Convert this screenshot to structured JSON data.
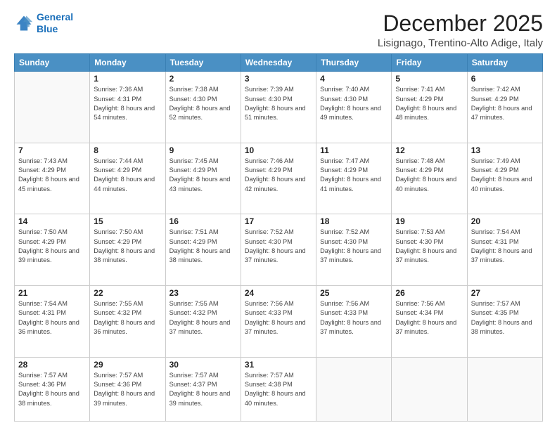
{
  "header": {
    "logo_line1": "General",
    "logo_line2": "Blue",
    "month": "December 2025",
    "location": "Lisignago, Trentino-Alto Adige, Italy"
  },
  "weekdays": [
    "Sunday",
    "Monday",
    "Tuesday",
    "Wednesday",
    "Thursday",
    "Friday",
    "Saturday"
  ],
  "weeks": [
    [
      {
        "day": "",
        "sunrise": "",
        "sunset": "",
        "daylight": ""
      },
      {
        "day": "1",
        "sunrise": "Sunrise: 7:36 AM",
        "sunset": "Sunset: 4:31 PM",
        "daylight": "Daylight: 8 hours and 54 minutes."
      },
      {
        "day": "2",
        "sunrise": "Sunrise: 7:38 AM",
        "sunset": "Sunset: 4:30 PM",
        "daylight": "Daylight: 8 hours and 52 minutes."
      },
      {
        "day": "3",
        "sunrise": "Sunrise: 7:39 AM",
        "sunset": "Sunset: 4:30 PM",
        "daylight": "Daylight: 8 hours and 51 minutes."
      },
      {
        "day": "4",
        "sunrise": "Sunrise: 7:40 AM",
        "sunset": "Sunset: 4:30 PM",
        "daylight": "Daylight: 8 hours and 49 minutes."
      },
      {
        "day": "5",
        "sunrise": "Sunrise: 7:41 AM",
        "sunset": "Sunset: 4:29 PM",
        "daylight": "Daylight: 8 hours and 48 minutes."
      },
      {
        "day": "6",
        "sunrise": "Sunrise: 7:42 AM",
        "sunset": "Sunset: 4:29 PM",
        "daylight": "Daylight: 8 hours and 47 minutes."
      }
    ],
    [
      {
        "day": "7",
        "sunrise": "Sunrise: 7:43 AM",
        "sunset": "Sunset: 4:29 PM",
        "daylight": "Daylight: 8 hours and 45 minutes."
      },
      {
        "day": "8",
        "sunrise": "Sunrise: 7:44 AM",
        "sunset": "Sunset: 4:29 PM",
        "daylight": "Daylight: 8 hours and 44 minutes."
      },
      {
        "day": "9",
        "sunrise": "Sunrise: 7:45 AM",
        "sunset": "Sunset: 4:29 PM",
        "daylight": "Daylight: 8 hours and 43 minutes."
      },
      {
        "day": "10",
        "sunrise": "Sunrise: 7:46 AM",
        "sunset": "Sunset: 4:29 PM",
        "daylight": "Daylight: 8 hours and 42 minutes."
      },
      {
        "day": "11",
        "sunrise": "Sunrise: 7:47 AM",
        "sunset": "Sunset: 4:29 PM",
        "daylight": "Daylight: 8 hours and 41 minutes."
      },
      {
        "day": "12",
        "sunrise": "Sunrise: 7:48 AM",
        "sunset": "Sunset: 4:29 PM",
        "daylight": "Daylight: 8 hours and 40 minutes."
      },
      {
        "day": "13",
        "sunrise": "Sunrise: 7:49 AM",
        "sunset": "Sunset: 4:29 PM",
        "daylight": "Daylight: 8 hours and 40 minutes."
      }
    ],
    [
      {
        "day": "14",
        "sunrise": "Sunrise: 7:50 AM",
        "sunset": "Sunset: 4:29 PM",
        "daylight": "Daylight: 8 hours and 39 minutes."
      },
      {
        "day": "15",
        "sunrise": "Sunrise: 7:50 AM",
        "sunset": "Sunset: 4:29 PM",
        "daylight": "Daylight: 8 hours and 38 minutes."
      },
      {
        "day": "16",
        "sunrise": "Sunrise: 7:51 AM",
        "sunset": "Sunset: 4:29 PM",
        "daylight": "Daylight: 8 hours and 38 minutes."
      },
      {
        "day": "17",
        "sunrise": "Sunrise: 7:52 AM",
        "sunset": "Sunset: 4:30 PM",
        "daylight": "Daylight: 8 hours and 37 minutes."
      },
      {
        "day": "18",
        "sunrise": "Sunrise: 7:52 AM",
        "sunset": "Sunset: 4:30 PM",
        "daylight": "Daylight: 8 hours and 37 minutes."
      },
      {
        "day": "19",
        "sunrise": "Sunrise: 7:53 AM",
        "sunset": "Sunset: 4:30 PM",
        "daylight": "Daylight: 8 hours and 37 minutes."
      },
      {
        "day": "20",
        "sunrise": "Sunrise: 7:54 AM",
        "sunset": "Sunset: 4:31 PM",
        "daylight": "Daylight: 8 hours and 37 minutes."
      }
    ],
    [
      {
        "day": "21",
        "sunrise": "Sunrise: 7:54 AM",
        "sunset": "Sunset: 4:31 PM",
        "daylight": "Daylight: 8 hours and 36 minutes."
      },
      {
        "day": "22",
        "sunrise": "Sunrise: 7:55 AM",
        "sunset": "Sunset: 4:32 PM",
        "daylight": "Daylight: 8 hours and 36 minutes."
      },
      {
        "day": "23",
        "sunrise": "Sunrise: 7:55 AM",
        "sunset": "Sunset: 4:32 PM",
        "daylight": "Daylight: 8 hours and 37 minutes."
      },
      {
        "day": "24",
        "sunrise": "Sunrise: 7:56 AM",
        "sunset": "Sunset: 4:33 PM",
        "daylight": "Daylight: 8 hours and 37 minutes."
      },
      {
        "day": "25",
        "sunrise": "Sunrise: 7:56 AM",
        "sunset": "Sunset: 4:33 PM",
        "daylight": "Daylight: 8 hours and 37 minutes."
      },
      {
        "day": "26",
        "sunrise": "Sunrise: 7:56 AM",
        "sunset": "Sunset: 4:34 PM",
        "daylight": "Daylight: 8 hours and 37 minutes."
      },
      {
        "day": "27",
        "sunrise": "Sunrise: 7:57 AM",
        "sunset": "Sunset: 4:35 PM",
        "daylight": "Daylight: 8 hours and 38 minutes."
      }
    ],
    [
      {
        "day": "28",
        "sunrise": "Sunrise: 7:57 AM",
        "sunset": "Sunset: 4:36 PM",
        "daylight": "Daylight: 8 hours and 38 minutes."
      },
      {
        "day": "29",
        "sunrise": "Sunrise: 7:57 AM",
        "sunset": "Sunset: 4:36 PM",
        "daylight": "Daylight: 8 hours and 39 minutes."
      },
      {
        "day": "30",
        "sunrise": "Sunrise: 7:57 AM",
        "sunset": "Sunset: 4:37 PM",
        "daylight": "Daylight: 8 hours and 39 minutes."
      },
      {
        "day": "31",
        "sunrise": "Sunrise: 7:57 AM",
        "sunset": "Sunset: 4:38 PM",
        "daylight": "Daylight: 8 hours and 40 minutes."
      },
      {
        "day": "",
        "sunrise": "",
        "sunset": "",
        "daylight": ""
      },
      {
        "day": "",
        "sunrise": "",
        "sunset": "",
        "daylight": ""
      },
      {
        "day": "",
        "sunrise": "",
        "sunset": "",
        "daylight": ""
      }
    ]
  ]
}
